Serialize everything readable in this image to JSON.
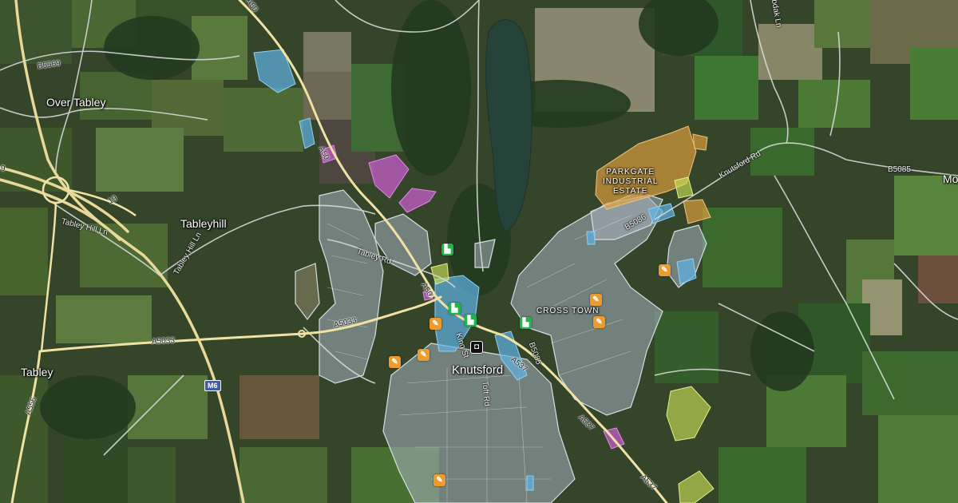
{
  "map": {
    "view": "satellite",
    "place_labels": {
      "over_tabley": "Over Tabley",
      "tableyhill": "Tableyhill",
      "tabley": "Tabley",
      "knutsford": "Knutsford",
      "cross_town": "CROSS TOWN",
      "parkgate_line1": "PARKGATE",
      "parkgate_line2": "INDUSTRIAL",
      "parkgate_line3": "ESTATE",
      "edge_label": "Mo"
    },
    "road_labels": {
      "a50_top": "A50",
      "a50_mid": "A50",
      "a50_town": "A50",
      "b5569": "B5569",
      "tabley_hill_ln_1": "Tabley Hill Ln",
      "tabley_hill_ln_2": "Tabley Hill Ln",
      "tabley_rd": "Tabley Rd",
      "a5033_left": "A5033",
      "a5033_right": "A5033",
      "a556": "A556",
      "knutsford_rd": "Knutsford Rd",
      "b5085_right": "B5085",
      "b5086": "B5086",
      "b5085_town": "B5085",
      "a537_upper": "A537",
      "a537_lower": "A537",
      "a537_bottom": "A537",
      "toft_rd": "Toft Rd",
      "king_st": "King St",
      "moss_lane": "bdak Ln",
      "m6_shield": "M6",
      "m6_ref_19": "19",
      "m6_ref_left": "9"
    },
    "colors": {
      "motorway": "#e8d89a",
      "a_road": "#f0e2a4",
      "minor_road": "#d8d8d8",
      "residential": "#a8b3c0",
      "retail_blue": "#5fb4e6",
      "industrial_orange": "#e7a53f",
      "commercial_pink": "#c65cc9",
      "lime": "#c8dc58",
      "lake": "#26433a",
      "school_marker": "#ee9b2e",
      "factory_marker": "#24b24a",
      "rail_marker": "#111111"
    },
    "markers": {
      "schools": [
        "school",
        "school",
        "school",
        "school",
        "school",
        "school",
        "school",
        "school",
        "school"
      ],
      "factories": [
        "factory",
        "factory",
        "factory",
        "factory",
        "factory"
      ],
      "railway_station": "train-station"
    }
  }
}
